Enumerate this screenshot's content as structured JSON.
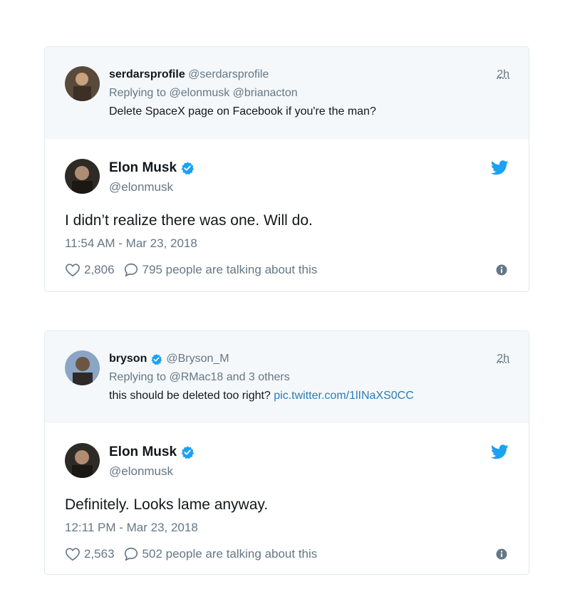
{
  "tweets": [
    {
      "parent": {
        "name": "serdarsprofile",
        "handle": "@serdarsprofile",
        "time": "2h",
        "replying_prefix": "Replying to ",
        "replying_to": "@elonmusk @brianacton",
        "text": "Delete SpaceX page on Facebook if you're the man?",
        "link": "",
        "verified": false,
        "avatar_icon": "user-avatar-icon"
      },
      "reply": {
        "name": "Elon Musk",
        "handle": "@elonmusk",
        "verified": true,
        "text": "I didn’t realize there was one. Will do.",
        "timestamp": "11:54 AM - Mar 23, 2018",
        "likes": "2,806",
        "talking": "795 people are talking about this",
        "avatar_icon": "elon-avatar-icon"
      }
    },
    {
      "parent": {
        "name": "bryson",
        "handle": "@Bryson_M",
        "time": "2h",
        "replying_prefix": "Replying to ",
        "replying_to": "@RMac18 and 3 others",
        "text": "this should be deleted too right? ",
        "link": "pic.twitter.com/1lINaXS0CC",
        "verified": true,
        "avatar_icon": "user-avatar-icon"
      },
      "reply": {
        "name": "Elon Musk",
        "handle": "@elonmusk",
        "verified": true,
        "text": "Definitely. Looks lame anyway.",
        "timestamp": "12:11 PM - Mar 23, 2018",
        "likes": "2,563",
        "talking": "502 people are talking about this",
        "avatar_icon": "elon-avatar-icon"
      }
    }
  ],
  "colors": {
    "twitter_blue": "#1da1f2",
    "link_blue": "#2b7bb9",
    "muted_gray": "#657786",
    "parent_bg": "#f5f8fa",
    "border": "#e1e8ed"
  }
}
